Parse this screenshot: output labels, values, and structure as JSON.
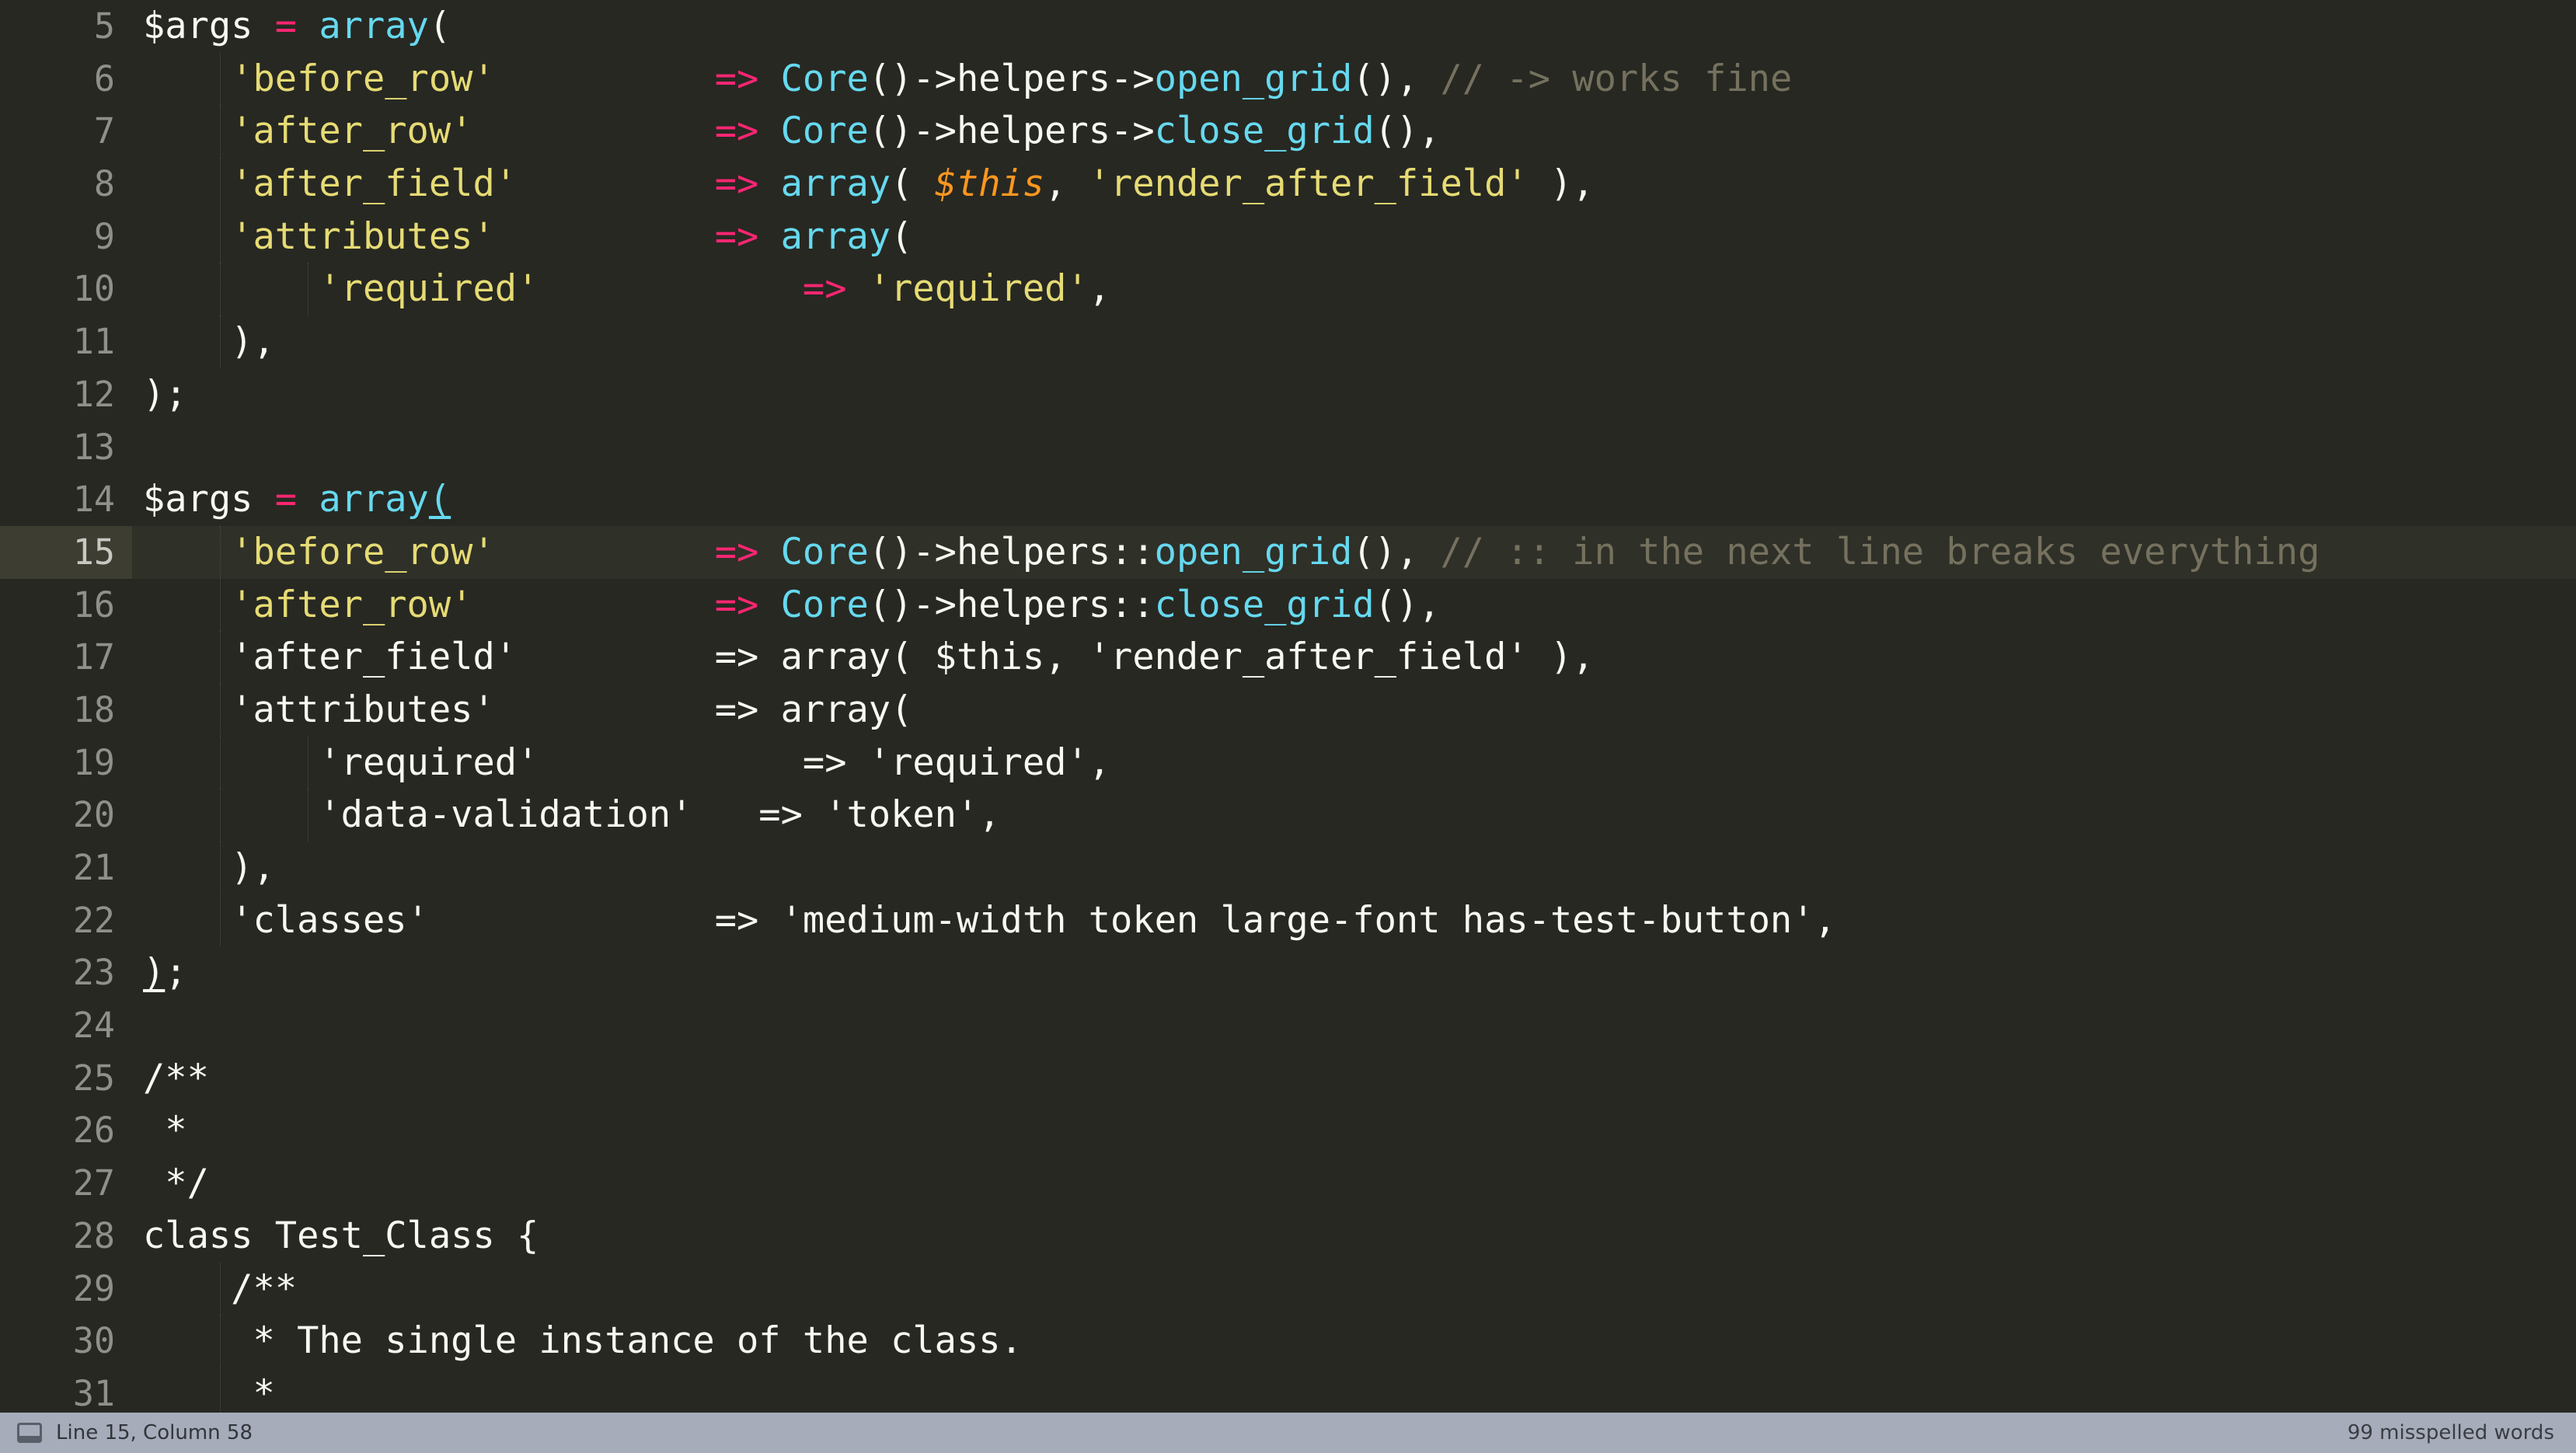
{
  "editor": {
    "theme_background": "#272822",
    "active_line_background": "#2f3028",
    "gutter_active_background": "#3e3d32",
    "colors": {
      "plain": "#f8f8f2",
      "operator": "#f92672",
      "function": "#66d9ef",
      "string": "#e6db74",
      "comment": "#75715e",
      "variable_this": "#fd971f",
      "line_number": "#8f908a",
      "status_bar_background": "#a6acb9"
    },
    "lines": [
      {
        "number": "5",
        "indent_guides": 0,
        "active": false,
        "tokens": [
          {
            "text": "$args ",
            "type": "plain"
          },
          {
            "text": "=",
            "type": "op"
          },
          {
            "text": " ",
            "type": "plain"
          },
          {
            "text": "array",
            "type": "fn"
          },
          {
            "text": "(",
            "type": "punc"
          }
        ]
      },
      {
        "number": "6",
        "indent_guides": 1,
        "active": false,
        "tokens": [
          {
            "text": "    ",
            "type": "plain"
          },
          {
            "text": "'before_row'",
            "type": "str"
          },
          {
            "text": "          ",
            "type": "plain"
          },
          {
            "text": "=>",
            "type": "op"
          },
          {
            "text": " ",
            "type": "plain"
          },
          {
            "text": "Core",
            "type": "fn"
          },
          {
            "text": "()->helpers->",
            "type": "punc"
          },
          {
            "text": "open_grid",
            "type": "fn"
          },
          {
            "text": "(), ",
            "type": "punc"
          },
          {
            "text": "// -> works fine",
            "type": "com"
          }
        ]
      },
      {
        "number": "7",
        "indent_guides": 1,
        "active": false,
        "tokens": [
          {
            "text": "    ",
            "type": "plain"
          },
          {
            "text": "'after_row'",
            "type": "str"
          },
          {
            "text": "           ",
            "type": "plain"
          },
          {
            "text": "=>",
            "type": "op"
          },
          {
            "text": " ",
            "type": "plain"
          },
          {
            "text": "Core",
            "type": "fn"
          },
          {
            "text": "()->helpers->",
            "type": "punc"
          },
          {
            "text": "close_grid",
            "type": "fn"
          },
          {
            "text": "(),",
            "type": "punc"
          }
        ]
      },
      {
        "number": "8",
        "indent_guides": 1,
        "active": false,
        "tokens": [
          {
            "text": "    ",
            "type": "plain"
          },
          {
            "text": "'after_field'",
            "type": "str"
          },
          {
            "text": "         ",
            "type": "plain"
          },
          {
            "text": "=>",
            "type": "op"
          },
          {
            "text": " ",
            "type": "plain"
          },
          {
            "text": "array",
            "type": "fn"
          },
          {
            "text": "( ",
            "type": "punc"
          },
          {
            "text": "$this",
            "type": "this"
          },
          {
            "text": ", ",
            "type": "punc"
          },
          {
            "text": "'render_after_field'",
            "type": "str"
          },
          {
            "text": " ),",
            "type": "punc"
          }
        ]
      },
      {
        "number": "9",
        "indent_guides": 1,
        "active": false,
        "tokens": [
          {
            "text": "    ",
            "type": "plain"
          },
          {
            "text": "'attributes'",
            "type": "str"
          },
          {
            "text": "          ",
            "type": "plain"
          },
          {
            "text": "=>",
            "type": "op"
          },
          {
            "text": " ",
            "type": "plain"
          },
          {
            "text": "array",
            "type": "fn"
          },
          {
            "text": "(",
            "type": "punc"
          }
        ]
      },
      {
        "number": "10",
        "indent_guides": 2,
        "active": false,
        "tokens": [
          {
            "text": "        ",
            "type": "plain"
          },
          {
            "text": "'required'",
            "type": "str"
          },
          {
            "text": "            ",
            "type": "plain"
          },
          {
            "text": "=>",
            "type": "op"
          },
          {
            "text": " ",
            "type": "plain"
          },
          {
            "text": "'required'",
            "type": "str"
          },
          {
            "text": ",",
            "type": "punc"
          }
        ]
      },
      {
        "number": "11",
        "indent_guides": 1,
        "active": false,
        "tokens": [
          {
            "text": "    ),",
            "type": "punc"
          }
        ]
      },
      {
        "number": "12",
        "indent_guides": 0,
        "active": false,
        "tokens": [
          {
            "text": ");",
            "type": "punc"
          }
        ]
      },
      {
        "number": "13",
        "indent_guides": 0,
        "active": false,
        "tokens": []
      },
      {
        "number": "14",
        "indent_guides": 0,
        "active": false,
        "tokens": [
          {
            "text": "$args ",
            "type": "plain"
          },
          {
            "text": "=",
            "type": "op"
          },
          {
            "text": " ",
            "type": "plain"
          },
          {
            "text": "array",
            "type": "fn"
          },
          {
            "text": "(",
            "type": "fn",
            "bracket_match": true
          }
        ]
      },
      {
        "number": "15",
        "indent_guides": 1,
        "active": true,
        "tokens": [
          {
            "text": "    ",
            "type": "plain"
          },
          {
            "text": "'before_row'",
            "type": "str"
          },
          {
            "text": "          ",
            "type": "plain"
          },
          {
            "text": "=>",
            "type": "op"
          },
          {
            "text": " ",
            "type": "plain"
          },
          {
            "text": "Core",
            "type": "fn"
          },
          {
            "text": "()->helpers::",
            "type": "punc"
          },
          {
            "text": "open_grid",
            "type": "fn"
          },
          {
            "text": "(), ",
            "type": "punc"
          },
          {
            "text": "// :: in the next line breaks everything",
            "type": "com"
          }
        ]
      },
      {
        "number": "16",
        "indent_guides": 1,
        "active": false,
        "tokens": [
          {
            "text": "    ",
            "type": "plain"
          },
          {
            "text": "'after_row'",
            "type": "str"
          },
          {
            "text": "           ",
            "type": "plain"
          },
          {
            "text": "=>",
            "type": "op"
          },
          {
            "text": " ",
            "type": "plain"
          },
          {
            "text": "Core",
            "type": "fn"
          },
          {
            "text": "()->helpers::",
            "type": "punc"
          },
          {
            "text": "close_grid",
            "type": "fn"
          },
          {
            "text": "(),",
            "type": "punc"
          }
        ]
      },
      {
        "number": "17",
        "indent_guides": 1,
        "active": false,
        "tokens": [
          {
            "text": "    'after_field'         => array( $this, 'render_after_field' ),",
            "type": "plain"
          }
        ]
      },
      {
        "number": "18",
        "indent_guides": 1,
        "active": false,
        "tokens": [
          {
            "text": "    'attributes'          => array(",
            "type": "plain"
          }
        ]
      },
      {
        "number": "19",
        "indent_guides": 2,
        "active": false,
        "tokens": [
          {
            "text": "        'required'            => 'required',",
            "type": "plain"
          }
        ]
      },
      {
        "number": "20",
        "indent_guides": 2,
        "active": false,
        "tokens": [
          {
            "text": "        'data-validation'   => 'token',",
            "type": "plain"
          }
        ]
      },
      {
        "number": "21",
        "indent_guides": 1,
        "active": false,
        "tokens": [
          {
            "text": "    ),",
            "type": "plain"
          }
        ]
      },
      {
        "number": "22",
        "indent_guides": 1,
        "active": false,
        "tokens": [
          {
            "text": "    'classes'             => 'medium-width token large-font has-test-button',",
            "type": "plain"
          }
        ]
      },
      {
        "number": "23",
        "indent_guides": 0,
        "active": false,
        "tokens": [
          {
            "text": ")",
            "type": "plain",
            "bracket_match": true
          },
          {
            "text": ";",
            "type": "plain"
          }
        ]
      },
      {
        "number": "24",
        "indent_guides": 0,
        "active": false,
        "tokens": []
      },
      {
        "number": "25",
        "indent_guides": 0,
        "active": false,
        "tokens": [
          {
            "text": "/**",
            "type": "plain"
          }
        ]
      },
      {
        "number": "26",
        "indent_guides": 0,
        "active": false,
        "tokens": [
          {
            "text": " *",
            "type": "plain"
          }
        ]
      },
      {
        "number": "27",
        "indent_guides": 0,
        "active": false,
        "tokens": [
          {
            "text": " */",
            "type": "plain"
          }
        ]
      },
      {
        "number": "28",
        "indent_guides": 0,
        "active": false,
        "tokens": [
          {
            "text": "class Test_Class {",
            "type": "plain"
          }
        ]
      },
      {
        "number": "29",
        "indent_guides": 1,
        "active": false,
        "tokens": [
          {
            "text": "    /**",
            "type": "plain"
          }
        ]
      },
      {
        "number": "30",
        "indent_guides": 1,
        "active": false,
        "tokens": [
          {
            "text": "     * The single instance of the class.",
            "type": "plain"
          }
        ]
      },
      {
        "number": "31",
        "indent_guides": 1,
        "active": false,
        "tokens": [
          {
            "text": "     *",
            "type": "plain"
          }
        ]
      }
    ]
  },
  "status_bar": {
    "icon": "monitor-icon",
    "cursor_position": "Line 15, Column 58",
    "spell_check": "99 misspelled words"
  }
}
